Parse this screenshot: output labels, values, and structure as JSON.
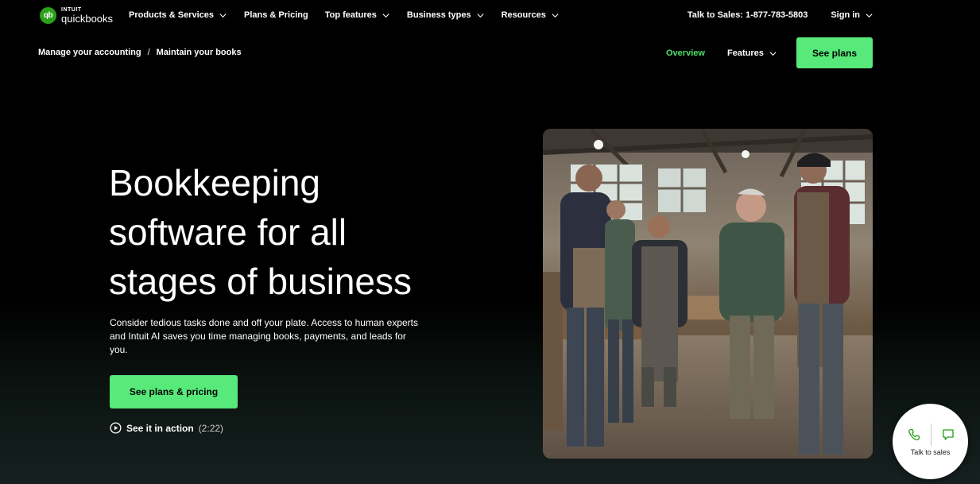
{
  "brand": {
    "logo_mark": "qb",
    "logo_top": "INTUIT",
    "logo_bottom": "quickbooks",
    "accent_color": "#57e97a",
    "brand_green": "#2ca01c"
  },
  "topnav": {
    "items": [
      {
        "label": "Products & Services",
        "has_dropdown": true
      },
      {
        "label": "Plans & Pricing",
        "has_dropdown": false
      },
      {
        "label": "Top features",
        "has_dropdown": true
      },
      {
        "label": "Business types",
        "has_dropdown": true
      },
      {
        "label": "Resources",
        "has_dropdown": true
      }
    ],
    "sales_phone": "Talk to Sales: 1-877-783-5803",
    "sign_in": "Sign in"
  },
  "subnav": {
    "breadcrumb": [
      "Manage your accounting",
      "Maintain your books"
    ],
    "breadcrumb_separator": "/",
    "overview": "Overview",
    "features": "Features",
    "see_plans": "See plans"
  },
  "hero": {
    "title_lines": [
      "Bookkeeping",
      "software for all",
      "stages of business"
    ],
    "description": "Consider tedious tasks done and off your plate. Access to human experts and Intuit AI saves you time managing books, payments, and leads for you.",
    "cta": "See plans & pricing",
    "video_label": "See it in action",
    "video_duration": "(2:22)",
    "image_subject": "workshop-team-photo"
  },
  "widget": {
    "label": "Talk to sales",
    "icons": [
      "phone-icon",
      "chat-icon"
    ]
  }
}
